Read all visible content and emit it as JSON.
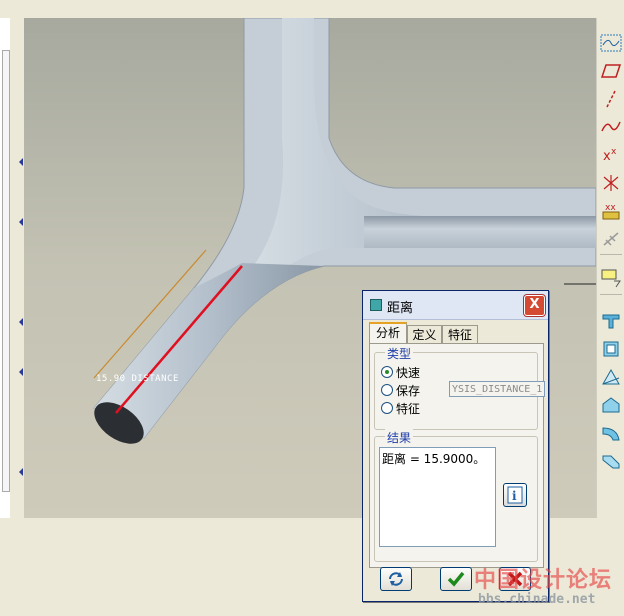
{
  "viewport": {
    "measure_label": "15.90  DISTANCE"
  },
  "dialog": {
    "title": "距离",
    "close_label": "X",
    "tabs": [
      {
        "label": "分析",
        "active": true
      },
      {
        "label": "定义",
        "active": false
      },
      {
        "label": "特征",
        "active": false
      }
    ],
    "type_group": {
      "title": "类型",
      "options": [
        {
          "label": "快速",
          "selected": true
        },
        {
          "label": "保存",
          "selected": false
        },
        {
          "label": "特征",
          "selected": false
        }
      ],
      "save_name": "YSIS_DISTANCE_1"
    },
    "result_group": {
      "title": "结果",
      "text": "距离 = 15.9000。"
    },
    "info_label": "i"
  },
  "watermark": {
    "line1": "中国设计论坛",
    "line2": "bbs.chinade.net"
  },
  "colors": {
    "background": "#c4c3b4",
    "part": "#b7c3cf",
    "measure_edge": "#e01020",
    "dialog_title": "#dfe7f5"
  }
}
